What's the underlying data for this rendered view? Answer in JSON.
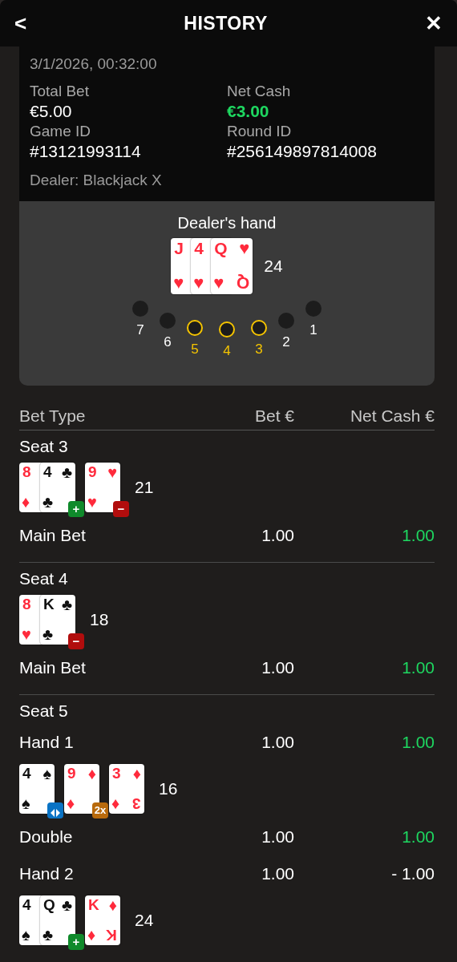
{
  "header": {
    "back": "<",
    "title": "HISTORY",
    "close": "✕"
  },
  "info": {
    "datetime": "3/1/2026, 00:32:00",
    "fields": [
      {
        "label": "Total Bet",
        "value": "€5.00",
        "highlight": false
      },
      {
        "label": "Net Cash",
        "value": "€3.00",
        "highlight": true
      },
      {
        "label": "Game ID",
        "value": "#13121993114",
        "highlight": false
      },
      {
        "label": "Round ID",
        "value": "#256149897814008",
        "highlight": false
      }
    ],
    "dealer": "Dealer: Blackjack X"
  },
  "dealer_hand": {
    "title": "Dealer's hand",
    "total": "24",
    "groups": [
      {
        "cards": [
          {
            "rank": "J",
            "suit": "♥",
            "color": "#ff2a3c"
          },
          {
            "rank": "4",
            "suit": "♥",
            "color": "#ff2a3c"
          },
          {
            "rank": "Q",
            "suit": "♥",
            "color": "#ff2a3c",
            "corner": "Q"
          }
        ]
      }
    ],
    "seats": [
      {
        "number": "7",
        "selected": false
      },
      {
        "number": "6",
        "selected": false
      },
      {
        "number": "5",
        "selected": true
      },
      {
        "number": "4",
        "selected": true
      },
      {
        "number": "3",
        "selected": true
      },
      {
        "number": "2",
        "selected": false
      },
      {
        "number": "1",
        "selected": false
      }
    ]
  },
  "table": {
    "columns": [
      "Bet Type",
      "Bet €",
      "Net Cash €"
    ],
    "sections": [
      {
        "title": "Seat 3",
        "rows": [
          {
            "kind": "hand",
            "total": "21",
            "groups": [
              {
                "cards": [
                  {
                    "rank": "8",
                    "suit": "♦",
                    "color": "#ff2a3c"
                  },
                  {
                    "rank": "4",
                    "suit": "♣",
                    "color": "#111111"
                  }
                ],
                "badge": {
                  "kind": "plus",
                  "label": "+"
                }
              },
              {
                "cards": [
                  {
                    "rank": "9",
                    "suit": "♥",
                    "color": "#ff2a3c"
                  }
                ],
                "badge": {
                  "kind": "minus",
                  "label": "−"
                }
              }
            ]
          },
          {
            "kind": "bet",
            "label": "Main Bet",
            "bet": "1.00",
            "net": "1.00",
            "won": true
          }
        ]
      },
      {
        "title": "Seat 4",
        "rows": [
          {
            "kind": "hand",
            "total": "18",
            "groups": [
              {
                "cards": [
                  {
                    "rank": "8",
                    "suit": "♥",
                    "color": "#ff2a3c"
                  },
                  {
                    "rank": "K",
                    "suit": "♣",
                    "color": "#111111"
                  }
                ],
                "badge": {
                  "kind": "minus",
                  "label": "−"
                }
              }
            ]
          },
          {
            "kind": "bet",
            "label": "Main Bet",
            "bet": "1.00",
            "net": "1.00",
            "won": true
          }
        ]
      },
      {
        "title": "Seat 5",
        "rows": [
          {
            "kind": "bet",
            "label": "Hand 1",
            "bet": "1.00",
            "net": "1.00",
            "won": true
          },
          {
            "kind": "hand",
            "total": "16",
            "groups": [
              {
                "cards": [
                  {
                    "rank": "4",
                    "suit": "♠",
                    "color": "#111111"
                  }
                ],
                "badge": {
                  "kind": "split"
                }
              },
              {
                "cards": [
                  {
                    "rank": "9",
                    "suit": "♦",
                    "color": "#ff2a3c"
                  }
                ],
                "badge": {
                  "kind": "double",
                  "label": "2x"
                }
              },
              {
                "cards": [
                  {
                    "rank": "3",
                    "suit": "♦",
                    "color": "#ff2a3c",
                    "corner": "3"
                  }
                ]
              }
            ]
          },
          {
            "kind": "bet",
            "label": "Double",
            "bet": "1.00",
            "net": "1.00",
            "won": true
          },
          {
            "kind": "bet",
            "label": "Hand 2",
            "bet": "1.00",
            "net": "- 1.00",
            "won": false
          },
          {
            "kind": "hand",
            "total": "24",
            "groups": [
              {
                "cards": [
                  {
                    "rank": "4",
                    "suit": "♠",
                    "color": "#111111"
                  },
                  {
                    "rank": "Q",
                    "suit": "♣",
                    "color": "#111111"
                  }
                ],
                "badge": {
                  "kind": "plus",
                  "label": "+"
                }
              },
              {
                "cards": [
                  {
                    "rank": "K",
                    "suit": "♦",
                    "color": "#ff2a3c",
                    "corner": "K"
                  }
                ]
              }
            ]
          }
        ]
      }
    ]
  }
}
